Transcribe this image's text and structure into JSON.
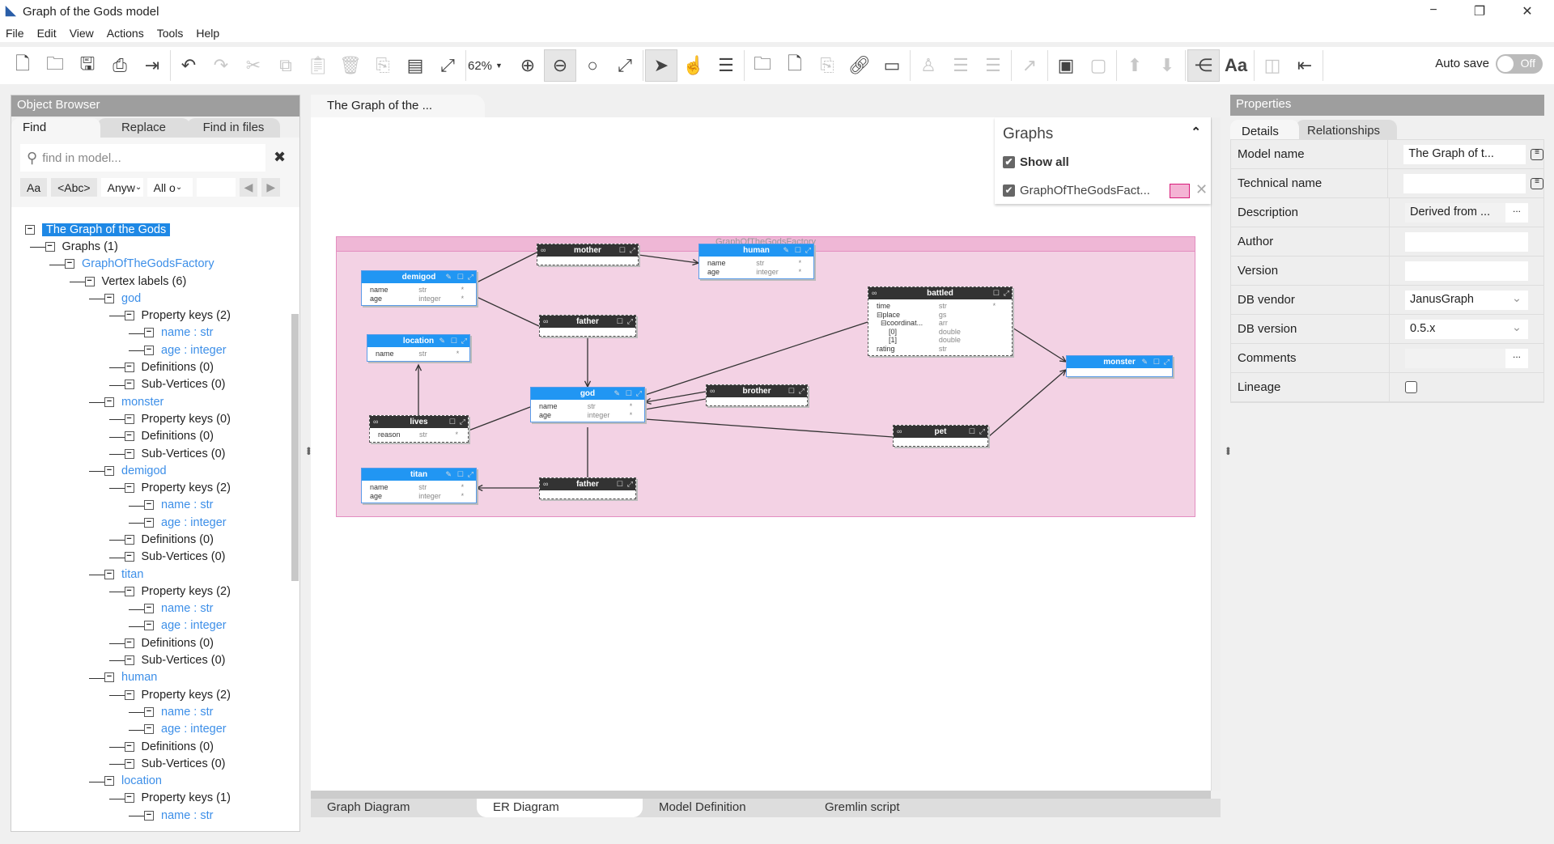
{
  "window": {
    "title": "Graph of the Gods model",
    "minimize": "−",
    "maximize": "❐",
    "close": "✕"
  },
  "menu": [
    "File",
    "Edit",
    "View",
    "Actions",
    "Tools",
    "Help"
  ],
  "toolbar": {
    "zoom": "62%",
    "autosave_label": "Auto save",
    "autosave_state": "Off"
  },
  "object_browser": {
    "title": "Object Browser",
    "tabs": [
      "Find",
      "Replace",
      "Find in files"
    ],
    "search_placeholder": "find in model...",
    "filters": {
      "case": "Aa",
      "whole": "<Abc>",
      "scope": "Anyw",
      "type": "All o"
    },
    "tree": [
      {
        "label": "The Graph of the Gods",
        "level": 0,
        "kind": "selected"
      },
      {
        "label": "Graphs (1)",
        "level": 1
      },
      {
        "label": "GraphOfTheGodsFactory",
        "level": 2,
        "kind": "link"
      },
      {
        "label": "Vertex labels (6)",
        "level": 3
      },
      {
        "label": "god",
        "level": 4,
        "kind": "link"
      },
      {
        "label": "Property keys (2)",
        "level": 5
      },
      {
        "label": "name : str",
        "level": 6,
        "kind": "link"
      },
      {
        "label": "age : integer",
        "level": 6,
        "kind": "link"
      },
      {
        "label": "Definitions (0)",
        "level": 5
      },
      {
        "label": "Sub-Vertices (0)",
        "level": 5
      },
      {
        "label": "monster",
        "level": 4,
        "kind": "link"
      },
      {
        "label": "Property keys (0)",
        "level": 5
      },
      {
        "label": "Definitions (0)",
        "level": 5
      },
      {
        "label": "Sub-Vertices (0)",
        "level": 5
      },
      {
        "label": "demigod",
        "level": 4,
        "kind": "link"
      },
      {
        "label": "Property keys (2)",
        "level": 5
      },
      {
        "label": "name : str",
        "level": 6,
        "kind": "link"
      },
      {
        "label": "age : integer",
        "level": 6,
        "kind": "link"
      },
      {
        "label": "Definitions (0)",
        "level": 5
      },
      {
        "label": "Sub-Vertices (0)",
        "level": 5
      },
      {
        "label": "titan",
        "level": 4,
        "kind": "link"
      },
      {
        "label": "Property keys (2)",
        "level": 5
      },
      {
        "label": "name : str",
        "level": 6,
        "kind": "link"
      },
      {
        "label": "age : integer",
        "level": 6,
        "kind": "link"
      },
      {
        "label": "Definitions (0)",
        "level": 5
      },
      {
        "label": "Sub-Vertices (0)",
        "level": 5
      },
      {
        "label": "human",
        "level": 4,
        "kind": "link"
      },
      {
        "label": "Property keys (2)",
        "level": 5
      },
      {
        "label": "name : str",
        "level": 6,
        "kind": "link"
      },
      {
        "label": "age : integer",
        "level": 6,
        "kind": "link"
      },
      {
        "label": "Definitions (0)",
        "level": 5
      },
      {
        "label": "Sub-Vertices (0)",
        "level": 5
      },
      {
        "label": "location",
        "level": 4,
        "kind": "link"
      },
      {
        "label": "Property keys (1)",
        "level": 5
      },
      {
        "label": "name : str",
        "level": 6,
        "kind": "link"
      }
    ]
  },
  "editor": {
    "doc_tab": "The Graph of the ...",
    "bottom_tabs": [
      "Graph Diagram",
      "ER Diagram",
      "Model Definition",
      "Gremlin script"
    ],
    "active_bottom_tab": "ER Diagram",
    "graphs_panel": {
      "title": "Graphs",
      "show_all": "Show all",
      "graph": "GraphOfTheGodsFact...",
      "graph_color": "#f4b3d4"
    },
    "frame_title": "GraphOfTheGodsFactory"
  },
  "diagram": {
    "vertices": {
      "demigod": {
        "name": "demigod",
        "props": [
          [
            "name",
            "str",
            "*"
          ],
          [
            "age",
            "integer",
            "*"
          ]
        ]
      },
      "human": {
        "name": "human",
        "props": [
          [
            "name",
            "str",
            "*"
          ],
          [
            "age",
            "integer",
            "*"
          ]
        ]
      },
      "location": {
        "name": "location",
        "props": [
          [
            "name",
            "str",
            "*"
          ]
        ]
      },
      "god": {
        "name": "god",
        "props": [
          [
            "name",
            "str",
            "*"
          ],
          [
            "age",
            "integer",
            "*"
          ]
        ]
      },
      "titan": {
        "name": "titan",
        "props": [
          [
            "name",
            "str",
            "*"
          ],
          [
            "age",
            "integer",
            "*"
          ]
        ]
      },
      "monster": {
        "name": "monster",
        "props": []
      }
    },
    "edges": {
      "mother": {
        "name": "mother",
        "props": []
      },
      "father1": {
        "name": "father",
        "props": []
      },
      "lives": {
        "name": "lives",
        "props": [
          [
            "reason",
            "str",
            "*"
          ]
        ]
      },
      "father2": {
        "name": "father",
        "props": []
      },
      "brother": {
        "name": "brother",
        "props": []
      },
      "battled": {
        "name": "battled",
        "props": [
          [
            "time",
            "str",
            "*"
          ],
          [
            "⊟place",
            "gs",
            ""
          ],
          [
            "  ⊟coordinat...",
            "arr",
            ""
          ],
          [
            "      [0]",
            "double",
            ""
          ],
          [
            "      [1]",
            "double",
            ""
          ],
          [
            "rating",
            "str",
            ""
          ]
        ]
      },
      "pet": {
        "name": "pet",
        "props": []
      }
    }
  },
  "properties": {
    "title": "Properties",
    "tabs": [
      "Details",
      "Relationships"
    ],
    "rows": [
      {
        "label": "Model name",
        "value": "The Graph of t..."
      },
      {
        "label": "Technical name",
        "value": ""
      },
      {
        "label": "Description",
        "value": "Derived from ..."
      },
      {
        "label": "Author",
        "value": ""
      },
      {
        "label": "Version",
        "value": ""
      },
      {
        "label": "DB vendor",
        "value": "JanusGraph"
      },
      {
        "label": "DB version",
        "value": "0.5.x"
      },
      {
        "label": "Comments",
        "value": ""
      },
      {
        "label": "Lineage",
        "value": ""
      }
    ]
  }
}
